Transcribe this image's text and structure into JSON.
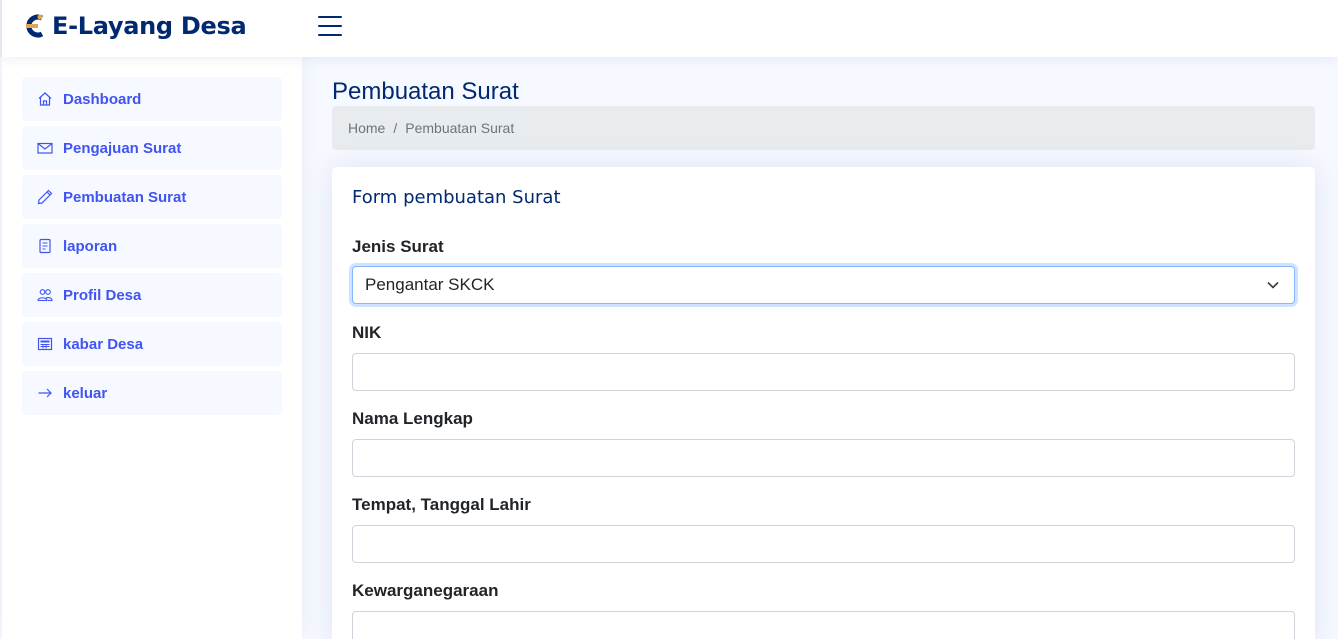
{
  "header": {
    "app_title": "E-Layang Desa",
    "logo_icon": "logo-icon",
    "menu_icon": "hamburger-icon"
  },
  "sidebar": {
    "items": [
      {
        "label": "Dashboard",
        "icon": "house-icon"
      },
      {
        "label": "Pengajuan Surat",
        "icon": "envelope-icon"
      },
      {
        "label": "Pembuatan Surat",
        "icon": "pencil-icon"
      },
      {
        "label": "laporan",
        "icon": "document-icon"
      },
      {
        "label": "Profil Desa",
        "icon": "people-icon"
      },
      {
        "label": "kabar Desa",
        "icon": "newspaper-icon"
      },
      {
        "label": "keluar",
        "icon": "arrow-right-icon"
      }
    ]
  },
  "page": {
    "title": "Pembuatan Surat",
    "breadcrumb": [
      "Home",
      "Pembuatan Surat"
    ],
    "breadcrumb_separator": "/"
  },
  "form": {
    "title": "Form pembuatan Surat",
    "jenis_label": "Jenis Surat",
    "jenis_value": "Pengantar SKCK",
    "nik_label": "NIK",
    "nik_value": "",
    "nama_label": "Nama Lengkap",
    "nama_value": "",
    "ttl_label": "Tempat, Tanggal Lahir",
    "ttl_value": "",
    "kewarganegaraan_label": "Kewarganegaraan",
    "kewarganegaraan_value": ""
  },
  "colors": {
    "brand": "#012970",
    "accent": "#4154f1",
    "background": "#f6f9ff",
    "logo_gold": "#e0a84b"
  }
}
